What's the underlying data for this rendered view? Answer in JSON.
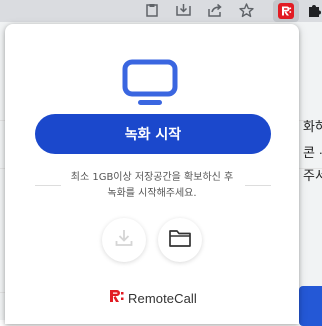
{
  "toolbar": {
    "icons": [
      "clipboard-icon",
      "install-icon",
      "share-icon",
      "bookmark-star-icon",
      "remotecall-extension-icon",
      "extensions-icon"
    ],
    "extension_badge": "R:"
  },
  "popup": {
    "record_button_label": "녹화 시작",
    "notice_line1": "최소 1GB이상 저장공간을 확보하신 후",
    "notice_line2": "녹화를 시작해주세요.",
    "download_icon": "download-icon",
    "folder_icon": "folder-icon",
    "brand_mark": "R:",
    "brand_name": "RemoteCall"
  },
  "background": {
    "text_lines": [
      "화하",
      "콘 ·",
      "주서"
    ]
  },
  "colors": {
    "accent": "#1b48cc",
    "brand_red": "#e21b23",
    "monitor_blue": "#3a66e0"
  }
}
